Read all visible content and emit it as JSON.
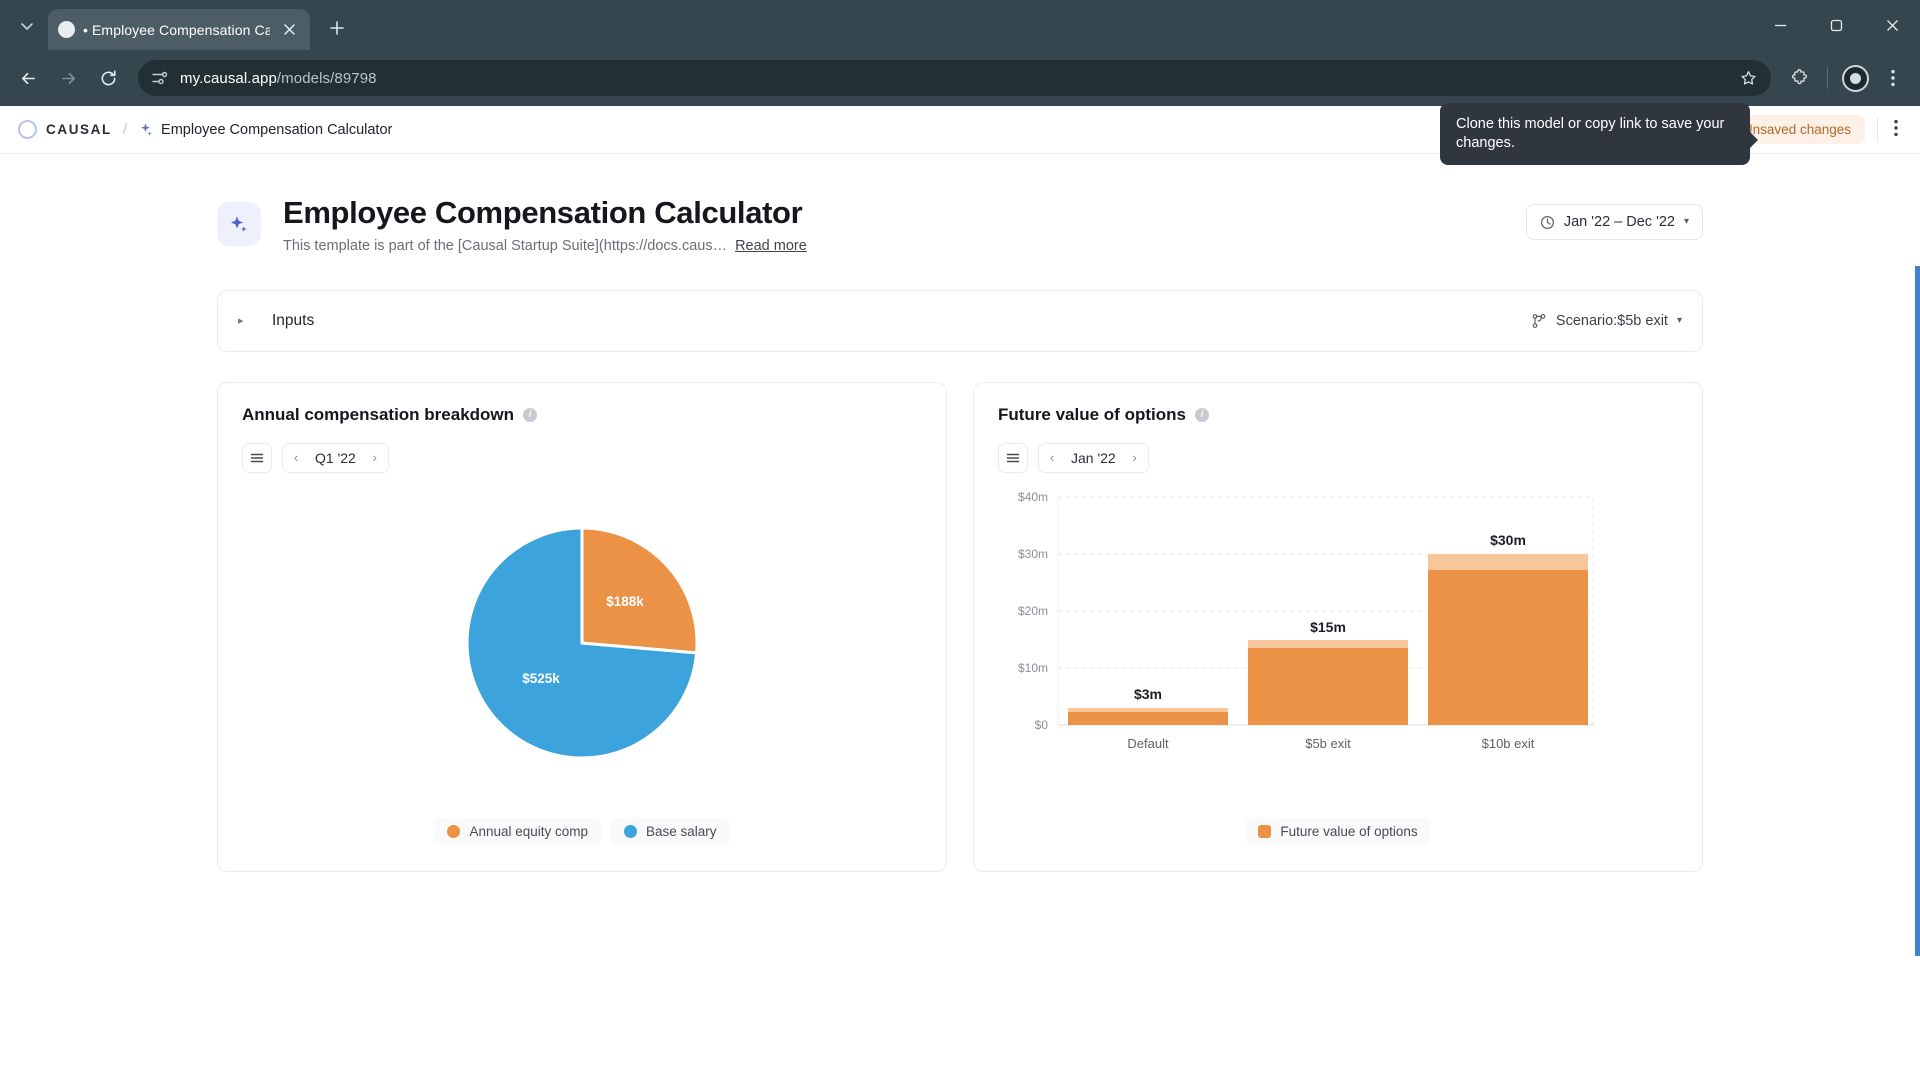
{
  "browser": {
    "tab": {
      "title": "• Employee Compensation Calc",
      "close_icon": "close-icon",
      "favicon": "page-favicon"
    },
    "new_tab_label": "+",
    "tab_search_icon": "chevron-down-icon",
    "window": {
      "minimize": "–",
      "maximize": "▢",
      "close": "✕"
    },
    "nav": {
      "back_icon": "arrow-left-icon",
      "forward_icon": "arrow-right-icon",
      "reload_icon": "reload-icon"
    },
    "omnibox": {
      "site_settings_icon": "tune-icon",
      "host": "my.causal.app",
      "path": "/models/89798",
      "bookmark_icon": "star-icon"
    },
    "extensions_icon": "puzzle-icon",
    "profile_icon": "profile-avatar",
    "menu_icon": "kebab-menu-icon"
  },
  "app_header": {
    "brand": "CAUSAL",
    "brand_icon": "causal-logo-icon",
    "separator": "/",
    "model_icon": "sparkle-icon",
    "model_name": "Employee Compensation Calculator",
    "tooltip": "Clone this model or copy link to save your changes.",
    "unsaved": {
      "icon": "!",
      "label": "Unsaved changes"
    },
    "overflow_icon": "kebab-menu-icon"
  },
  "page": {
    "icon": "sparkle-icon",
    "title": "Employee Compensation Calculator",
    "subtitle": "This template is part of the [Causal Startup Suite](https://docs.caus…",
    "read_more": "Read more",
    "date_range": {
      "icon": "clock-icon",
      "label": "Jan '22 – Dec '22",
      "caret": "▾"
    }
  },
  "inputs_section": {
    "disclosure": "▸",
    "label": "Inputs",
    "scenario": {
      "icon": "branch-icon",
      "label": "Scenario:$5b exit",
      "caret": "▾"
    }
  },
  "cards": {
    "pie_card": {
      "title": "Annual compensation breakdown",
      "info_icon": "info-icon",
      "menu_icon": "list-view-icon",
      "period": {
        "prev": "‹",
        "label": "Q1 '22",
        "next": "›"
      }
    },
    "bar_card": {
      "title": "Future value of options",
      "info_icon": "info-icon",
      "menu_icon": "list-view-icon",
      "period": {
        "prev": "‹",
        "label": "Jan '22",
        "next": "›"
      }
    }
  },
  "colors": {
    "orange": "#ec9247",
    "orange_light": "#f5c79a",
    "blue": "#3ca3dc",
    "accent_edge": "#3f82d0",
    "unsaved_bg": "#fdf1e7",
    "unsaved_fg": "#b06a2a"
  },
  "chart_data": [
    {
      "type": "pie",
      "title": "Annual compensation breakdown",
      "period": "Q1 '22",
      "labels": [
        "Annual equity comp",
        "Base salary"
      ],
      "values": [
        188,
        525
      ],
      "value_labels": [
        "$188k",
        "$525k"
      ],
      "colors": [
        "#ec9247",
        "#3ca3dc"
      ],
      "legend_position": "bottom",
      "start_angle_deg": 0
    },
    {
      "type": "bar",
      "title": "Future value of options",
      "period": "Jan '22",
      "categories": [
        "Default",
        "$5b exit",
        "$10b exit"
      ],
      "values": [
        3,
        15,
        30
      ],
      "value_labels": [
        "$3m",
        "$15m",
        "$30m"
      ],
      "series": [
        {
          "name": "Future value of options",
          "values": [
            3,
            15,
            30
          ]
        }
      ],
      "ylabel": "",
      "xlabel": "",
      "ylim": [
        0,
        40
      ],
      "yticks": [
        0,
        10,
        20,
        30,
        40
      ],
      "ytick_labels": [
        "$0",
        "$10m",
        "$20m",
        "$30m",
        "$40m"
      ],
      "grid": true,
      "legend": [
        "Future value of options"
      ],
      "legend_position": "bottom",
      "color": "#ec9247",
      "cap_color": "#f5c79a"
    }
  ]
}
